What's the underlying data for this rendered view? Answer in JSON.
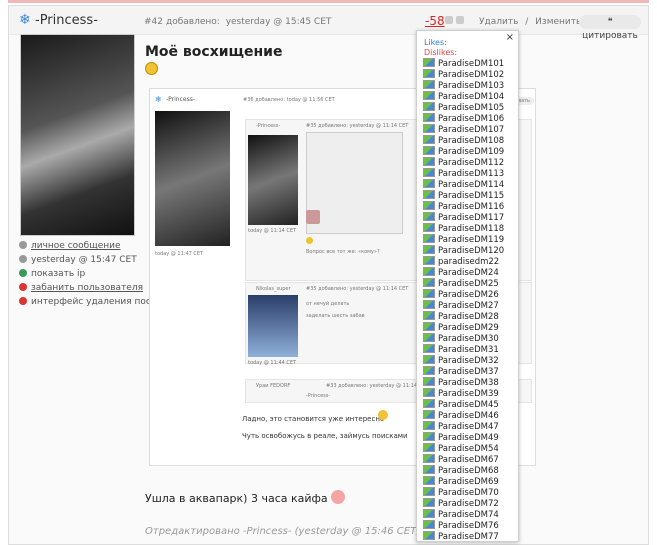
{
  "post": {
    "author": "-Princess-",
    "number": "#42",
    "added_label": "добавлено:",
    "added_time": "yesterday @ 15:45 CET",
    "score": "-58",
    "delete": "Удалить",
    "separator": "/",
    "edit": "Изменить",
    "quote": "цитировать",
    "title": "Моё восхищение",
    "body_text": "Ушла в аквапарк) 3 часа кайфа",
    "edited": "Отредактировано -Princess- (yesterday @ 15:46 CET)"
  },
  "sidebar": {
    "items": [
      {
        "label": "личное сообщение",
        "color": "#888"
      },
      {
        "label": "yesterday @ 15:47 CET",
        "color": "#888"
      },
      {
        "label": "показать ip",
        "color": "#4a8"
      },
      {
        "label": "забанить пользователя",
        "color": "#d33"
      },
      {
        "label": "интерфейс удаления постов",
        "color": "#d33"
      }
    ]
  },
  "quoted": {
    "author": "-Princess-",
    "meta": "#36 добавлено: today @ 11:56 CET",
    "quote": "цитировать",
    "footer": "today @ 11:47 CET",
    "nested_author": "-Princess-",
    "nested_meta": "#35 добавлено: yesterday @ 11:14 CET",
    "nested_footer": "today @ 11:14 CET",
    "nested_text": "Вопрос все тот же: «кому»?",
    "reply2_author": "Nikolas_super",
    "reply2_meta": "#35 добавлено: yesterday @ 11:14 CET",
    "reply2_line1": "от нечуй делать",
    "reply2_line2": "заделать шесть забав",
    "reply2_footer": "today @ 11:44 CET",
    "reply3_author": "Ураи FEDORF",
    "reply3_meta": "#33 добавлено: yesterday @ 11:14 CET",
    "reply3_line": "-Princess-",
    "line1": "Ладно, это становится уже интересно",
    "line2": "Чуть освобожусь в реале, займусь поисками"
  },
  "popup": {
    "close": "×",
    "likes": "Likes:",
    "dislikes": "Dislikes:",
    "users": [
      "ParadiseDM101",
      "ParadiseDM102",
      "ParadiseDM103",
      "ParadiseDM104",
      "ParadiseDM105",
      "ParadiseDM106",
      "ParadiseDM107",
      "ParadiseDM108",
      "ParadiseDM109",
      "ParadiseDM112",
      "ParadiseDM113",
      "ParadiseDM114",
      "ParadiseDM115",
      "ParadiseDM116",
      "ParadiseDM117",
      "ParadiseDM118",
      "ParadiseDM119",
      "ParadiseDM120",
      "paradisedm22",
      "ParadiseDM24",
      "ParadiseDM25",
      "ParadiseDM26",
      "ParadiseDM27",
      "ParadiseDM28",
      "ParadiseDM29",
      "ParadiseDM30",
      "ParadiseDM31",
      "ParadiseDM32",
      "ParadiseDM37",
      "ParadiseDM38",
      "ParadiseDM39",
      "ParadiseDM45",
      "ParadiseDM46",
      "ParadiseDM47",
      "ParadiseDM49",
      "ParadiseDM54",
      "ParadiseDM67",
      "ParadiseDM68",
      "ParadiseDM69",
      "ParadiseDM70",
      "ParadiseDM72",
      "ParadiseDM74",
      "ParadiseDM76",
      "ParadiseDM77"
    ]
  }
}
